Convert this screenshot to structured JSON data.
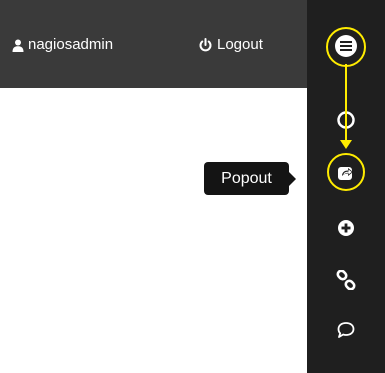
{
  "header": {
    "user_label": "nagiosadmin",
    "user_icon": "user-icon",
    "logout_label": "Logout",
    "logout_icon": "power-icon"
  },
  "sidebar": {
    "buttons": [
      {
        "name": "menu",
        "icon": "hamburger-icon"
      },
      {
        "name": "circle",
        "icon": "circle-icon"
      },
      {
        "name": "popout",
        "icon": "popout-icon"
      },
      {
        "name": "add",
        "icon": "plus-circle-icon"
      },
      {
        "name": "link",
        "icon": "link-icon"
      },
      {
        "name": "comment",
        "icon": "comment-icon"
      }
    ]
  },
  "tooltip": {
    "text": "Popout"
  },
  "colors": {
    "header_bg": "#3a3a3a",
    "sidebar_bg": "#1f1f1f",
    "highlight": "#ffec00",
    "tooltip_bg": "#141414"
  }
}
